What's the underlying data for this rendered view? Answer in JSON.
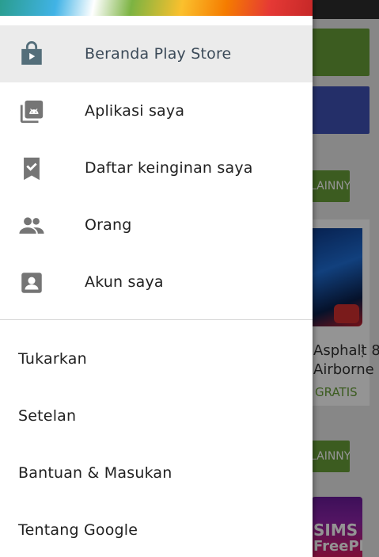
{
  "background_app": {
    "more_button_label": "LAINNYA",
    "card_title_line1": "Asphalt 8:",
    "card_title_line2": "Airborne",
    "card_price": "GRATIS",
    "card2_text_line1": "SIMS",
    "card2_text_line2": "FreePlay"
  },
  "drawer": {
    "primary_items": [
      {
        "label": "Beranda Play Store",
        "icon": "store-bag-icon",
        "active": true
      },
      {
        "label": "Aplikasi saya",
        "icon": "my-apps-icon",
        "active": false
      },
      {
        "label": "Daftar keinginan saya",
        "icon": "wishlist-bookmark-icon",
        "active": false
      },
      {
        "label": "Orang",
        "icon": "people-icon",
        "active": false
      },
      {
        "label": "Akun saya",
        "icon": "account-icon",
        "active": false
      }
    ],
    "secondary_items": [
      {
        "label": "Tukarkan"
      },
      {
        "label": "Setelan"
      },
      {
        "label": "Bantuan & Masukan"
      },
      {
        "label": "Tentang Google"
      }
    ]
  },
  "colors": {
    "active_label": "#3b4a58",
    "icon_gray": "#757575",
    "store_icon": "#546e7a",
    "accent_green": "#689f38"
  }
}
